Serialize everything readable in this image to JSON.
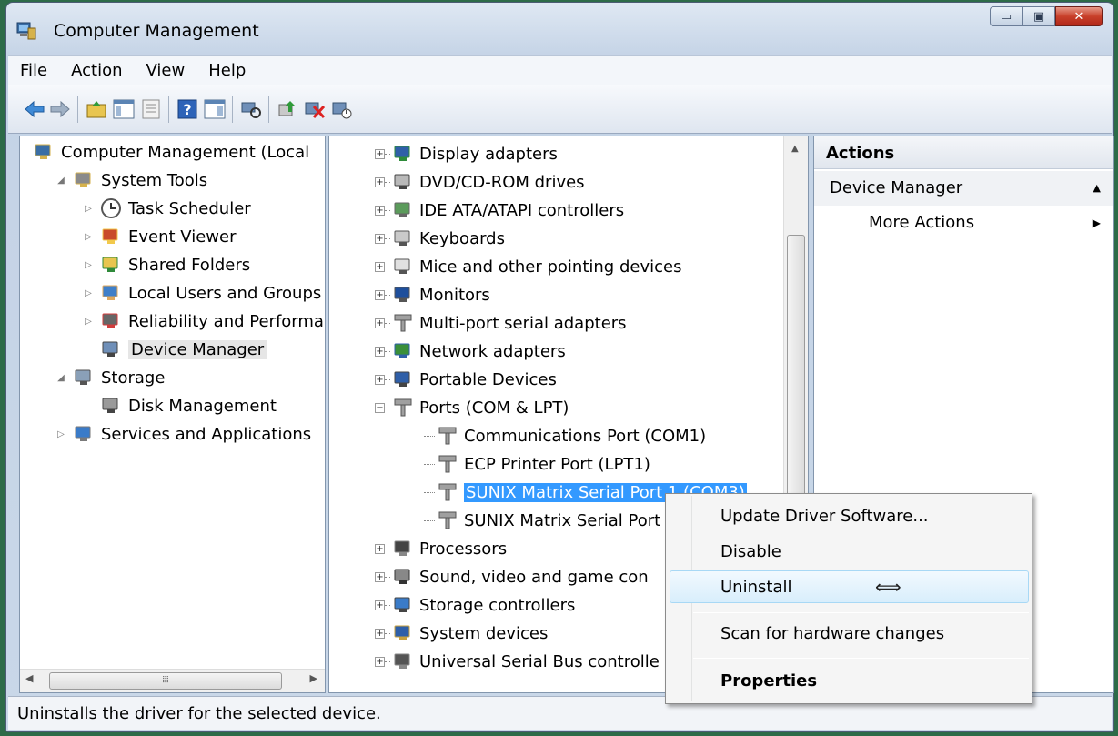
{
  "window": {
    "title": "Computer Management",
    "status_text": "Uninstalls the driver for the selected device."
  },
  "menubar": [
    "File",
    "Action",
    "View",
    "Help"
  ],
  "left_tree": [
    {
      "label": "Computer Management (Local",
      "level": 0,
      "arrow": "",
      "icon": "computer-management-icon"
    },
    {
      "label": "System Tools",
      "level": 1,
      "arrow": "◢",
      "icon": "system-tools-icon"
    },
    {
      "label": "Task Scheduler",
      "level": 2,
      "arrow": "▷",
      "icon": "clock-icon"
    },
    {
      "label": "Event Viewer",
      "level": 2,
      "arrow": "▷",
      "icon": "event-viewer-icon"
    },
    {
      "label": "Shared Folders",
      "level": 2,
      "arrow": "▷",
      "icon": "shared-folders-icon"
    },
    {
      "label": "Local Users and Groups",
      "level": 2,
      "arrow": "▷",
      "icon": "users-icon"
    },
    {
      "label": "Reliability and Performa",
      "level": 2,
      "arrow": "▷",
      "icon": "performance-icon"
    },
    {
      "label": "Device Manager",
      "level": 2,
      "arrow": "",
      "icon": "device-manager-icon",
      "selected": true
    },
    {
      "label": "Storage",
      "level": 1,
      "arrow": "◢",
      "icon": "storage-icon"
    },
    {
      "label": "Disk Management",
      "level": 2,
      "arrow": "",
      "icon": "disk-icon"
    },
    {
      "label": "Services and Applications",
      "level": 1,
      "arrow": "▷",
      "icon": "services-icon"
    }
  ],
  "device_tree": [
    {
      "label": "Display adapters",
      "level": 0,
      "expander": "+",
      "icon": "display-adapter-icon"
    },
    {
      "label": "DVD/CD-ROM drives",
      "level": 0,
      "expander": "+",
      "icon": "dvd-drive-icon"
    },
    {
      "label": "IDE ATA/ATAPI controllers",
      "level": 0,
      "expander": "+",
      "icon": "ide-controller-icon"
    },
    {
      "label": "Keyboards",
      "level": 0,
      "expander": "+",
      "icon": "keyboard-icon"
    },
    {
      "label": "Mice and other pointing devices",
      "level": 0,
      "expander": "+",
      "icon": "mouse-icon"
    },
    {
      "label": "Monitors",
      "level": 0,
      "expander": "+",
      "icon": "monitor-icon"
    },
    {
      "label": "Multi-port serial adapters",
      "level": 0,
      "expander": "+",
      "icon": "serial-port-icon"
    },
    {
      "label": "Network adapters",
      "level": 0,
      "expander": "+",
      "icon": "network-adapter-icon"
    },
    {
      "label": "Portable Devices",
      "level": 0,
      "expander": "+",
      "icon": "portable-device-icon"
    },
    {
      "label": "Ports (COM & LPT)",
      "level": 0,
      "expander": "−",
      "icon": "port-icon"
    },
    {
      "label": "Communications Port (COM1)",
      "level": 1,
      "expander": "",
      "icon": "port-icon"
    },
    {
      "label": "ECP Printer Port (LPT1)",
      "level": 1,
      "expander": "",
      "icon": "port-icon"
    },
    {
      "label": "SUNIX Matrix Serial Port 1 (COM3)",
      "level": 1,
      "expander": "",
      "icon": "port-icon",
      "selected": true
    },
    {
      "label": "SUNIX Matrix Serial Port",
      "level": 1,
      "expander": "",
      "icon": "port-icon"
    },
    {
      "label": "Processors",
      "level": 0,
      "expander": "+",
      "icon": "processor-icon"
    },
    {
      "label": "Sound, video and game con",
      "level": 0,
      "expander": "+",
      "icon": "sound-icon"
    },
    {
      "label": "Storage controllers",
      "level": 0,
      "expander": "+",
      "icon": "storage-controller-icon"
    },
    {
      "label": "System devices",
      "level": 0,
      "expander": "+",
      "icon": "system-devices-icon"
    },
    {
      "label": "Universal Serial Bus controlle",
      "level": 0,
      "expander": "+",
      "icon": "usb-icon"
    }
  ],
  "actions_panel": {
    "header": "Actions",
    "section": "Device Manager",
    "link": "More Actions"
  },
  "context_menu": {
    "items": [
      "Update Driver Software...",
      "Disable",
      "Uninstall",
      "Scan for hardware changes",
      "Properties"
    ],
    "hovered": "Uninstall",
    "cursor_glyph": "⟺"
  },
  "colors": {
    "selection": "#3399ff",
    "accent": "#c8402a"
  }
}
